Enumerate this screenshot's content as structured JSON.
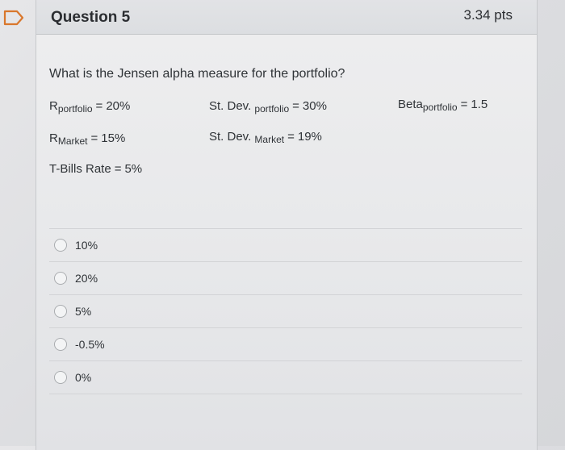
{
  "question": {
    "title": "Question 5",
    "points": "3.34 pts",
    "text": "What is the Jensen alpha measure for the portfolio?"
  },
  "variables": {
    "r_portfolio": {
      "base": "R",
      "sub": "portfolio",
      "value": "20%"
    },
    "r_market": {
      "base": "R",
      "sub": "Market",
      "value": "15%"
    },
    "tbills": {
      "label": "T-Bills Rate",
      "value": "5%"
    },
    "sd_portfolio": {
      "base": "St. Dev.",
      "sub": "portfolio",
      "value": "30%"
    },
    "sd_market": {
      "base": "St. Dev.",
      "sub": "Market",
      "value": "19%"
    },
    "beta_portfolio": {
      "base": "Beta",
      "sub": "portfolio",
      "value": "1.5"
    },
    "equals": "="
  },
  "answers": [
    "10%",
    "20%",
    "5%",
    "-0.5%",
    "0%"
  ]
}
